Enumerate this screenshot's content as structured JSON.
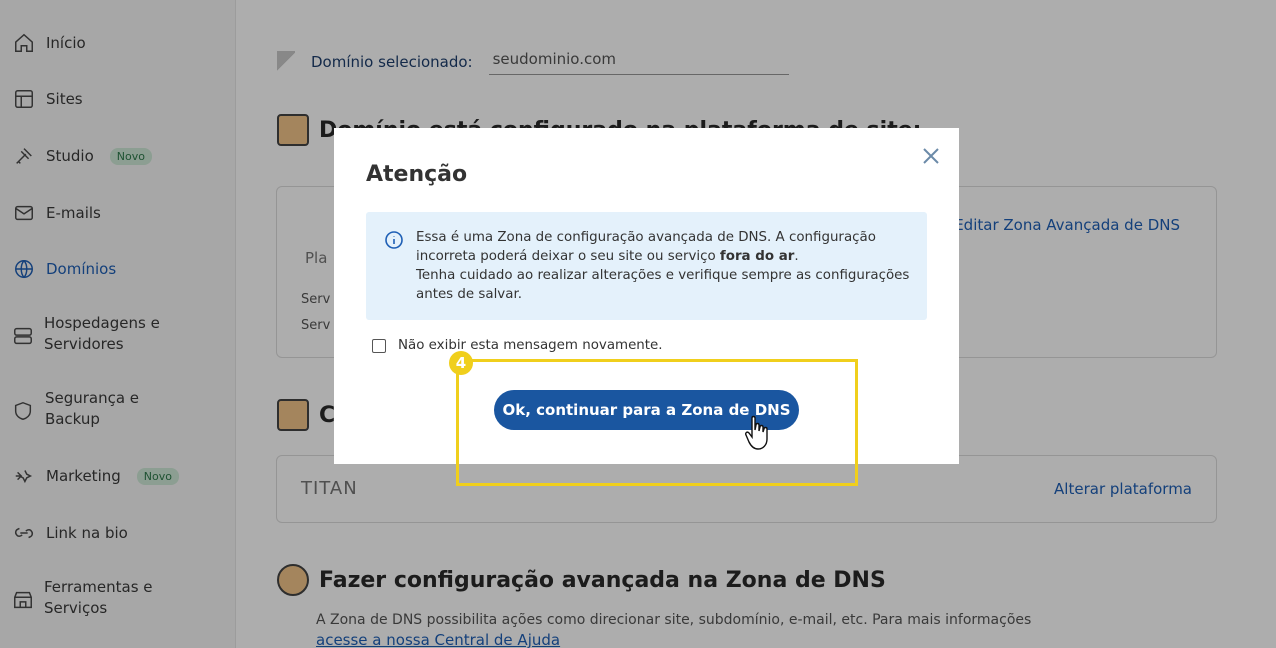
{
  "sidebar": {
    "items": [
      {
        "label": "Início",
        "icon": "home-icon"
      },
      {
        "label": "Sites",
        "icon": "layout-icon"
      },
      {
        "label": "Studio",
        "icon": "studio-icon",
        "badge": "Novo"
      },
      {
        "label": "E-mails",
        "icon": "mail-icon"
      },
      {
        "label": "Domínios",
        "icon": "globe-icon",
        "active": true
      },
      {
        "label": "Hospedagens e Servidores",
        "icon": "server-icon"
      },
      {
        "label": "Segurança e Backup",
        "icon": "shield-icon"
      },
      {
        "label": "Marketing",
        "icon": "marketing-icon",
        "badge": "Novo"
      },
      {
        "label": "Link na bio",
        "icon": "link-icon"
      },
      {
        "label": "Ferramentas e Serviços",
        "icon": "store-icon"
      }
    ]
  },
  "main": {
    "domain_label": "Domínio selecionado:",
    "domain_value": "seudominio.com",
    "section1_title": "Domínio está configurado na plataforma de site:",
    "edit_link": "Editar Zona Avançada de DNS",
    "partial1": "Pla",
    "partial2": "Serv",
    "partial3": "Serv",
    "section2_title_partial": "C",
    "titan_label": "TITAN",
    "alter_link": "Alterar plataforma",
    "section3_title": "Fazer configuração avançada na Zona de DNS",
    "section3_text": "A Zona de DNS possibilita ações como direcionar site, subdomínio, e-mail, etc. Para mais informações",
    "help_link": "acesse a nossa Central de Ajuda"
  },
  "modal": {
    "title": "Atenção",
    "alert_line1": "Essa é uma Zona de configuração avançada de DNS. A configuração incorreta poderá deixar o seu site ou serviço",
    "alert_bold": "fora do ar",
    "alert_line2": "Tenha cuidado ao realizar alterações e verifique sempre as configurações antes de salvar.",
    "checkbox_label": "Não exibir esta mensagem novamente.",
    "ok_button": "Ok, continuar para a Zona de DNS"
  },
  "annotation": {
    "step_number": "4",
    "highlight_color": "#f0cf1c"
  },
  "colors": {
    "primary": "#1a56a0",
    "alert_bg": "#e4f1fb",
    "active_nav": "#1e5fb5"
  }
}
